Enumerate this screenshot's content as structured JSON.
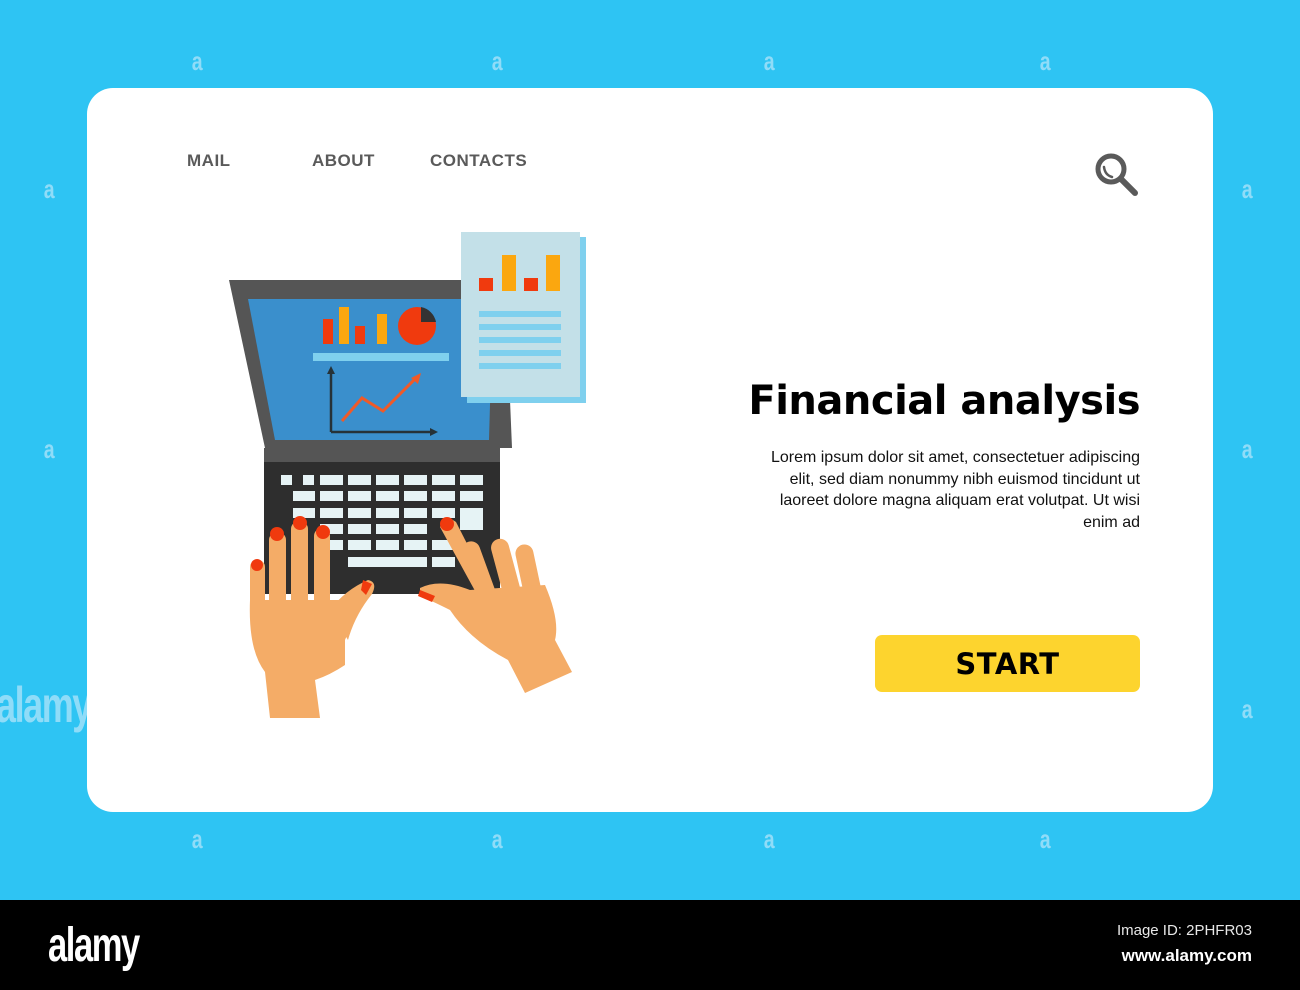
{
  "nav": {
    "items": [
      {
        "label": "MAIL"
      },
      {
        "label": "ABOUT"
      },
      {
        "label": "CONTACTS"
      }
    ],
    "search_icon": "search-icon"
  },
  "hero": {
    "title": "Financial analysis",
    "description": "Lorem ipsum dolor sit amet, consectetuer adipiscing elit, sed diam nonummy nibh euismod tincidunt ut laoreet dolore magna aliquam erat volutpat. Ut wisi enim ad",
    "start_label": "START"
  },
  "illustration": {
    "subject": "hands typing on laptop with financial charts and report document",
    "icons": [
      "laptop-icon",
      "bar-chart-icon",
      "pie-chart-icon",
      "line-chart-icon",
      "document-icon",
      "hands-icon"
    ]
  },
  "watermark": {
    "glyph": "a",
    "logo": "alamy"
  },
  "footer": {
    "logo": "alamy",
    "image_id": "Image ID: 2PHFR03",
    "url": "www.alamy.com"
  },
  "colors": {
    "background": "#2ec4f3",
    "card": "#ffffff",
    "nav_text": "#5a5a5a",
    "start_button": "#fdd42e",
    "screen_blue": "#3a8fcc",
    "laptop_gray": "#555555",
    "keyboard_dark": "#2e2e2e",
    "skin": "#f4ac67",
    "nail_red": "#f03a0e",
    "bar_orange": "#fba70f",
    "document": "#c3e0e8"
  }
}
